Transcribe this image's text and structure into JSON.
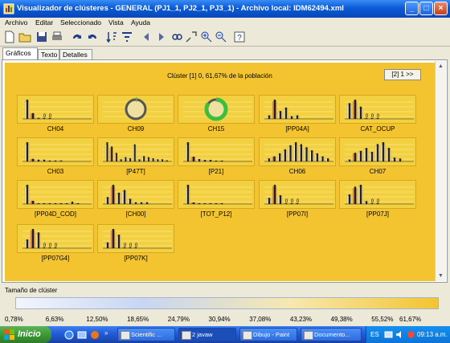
{
  "window": {
    "title": "Visualizador de clústeres - GENERAL (PJ1_1, PJ2_1, PJ3_1) - Archivo local: IDM62494.xml"
  },
  "menu": [
    "Archivo",
    "Editar",
    "Seleccionado",
    "Vista",
    "Ayuda"
  ],
  "toolbar": [
    "new-icon",
    "open-icon",
    "save-icon",
    "print-icon",
    "redo-icon",
    "undo-icon",
    "sort-icon",
    "filter-icon",
    "back-icon",
    "forward-icon",
    "link-icon",
    "zoom-fit-icon",
    "zoom-in-icon",
    "zoom-out-icon",
    "help-icon"
  ],
  "tabs": [
    "Gráficos",
    "Texto",
    "Detalles"
  ],
  "cluster": {
    "header": "Clúster [1] 0, 61,67% de la población",
    "nav_button": "[2] 1 >>"
  },
  "cells": [
    {
      "label": "CH04",
      "type": "bar",
      "values": [
        20,
        6,
        1,
        1,
        1
      ],
      "nums": [
        "",
        "",
        "",
        "0",
        "0"
      ]
    },
    {
      "label": "CH09",
      "type": "ring",
      "value": 0.02
    },
    {
      "label": "CH15",
      "type": "ring",
      "value": 0.85
    },
    {
      "label": "[PP04A]",
      "type": "bar",
      "values": [
        4,
        22,
        9,
        13,
        3,
        4
      ],
      "nums": []
    },
    {
      "label": "CAT_OCUP",
      "type": "bar",
      "values": [
        18,
        22,
        14,
        1,
        1,
        1
      ],
      "nums": [
        "",
        "",
        "",
        "0",
        "0",
        "0"
      ]
    },
    {
      "label": "CH03",
      "type": "bar",
      "values": [
        22,
        3,
        2,
        2,
        1,
        1,
        1
      ],
      "nums": []
    },
    {
      "label": "[P47T]",
      "type": "bar",
      "values": [
        18,
        14,
        8,
        2,
        4,
        3,
        16,
        2,
        5,
        4,
        3,
        2,
        2,
        1
      ],
      "nums": []
    },
    {
      "label": "[P21]",
      "type": "bar",
      "values": [
        24,
        6,
        3,
        2,
        2,
        1,
        1
      ],
      "nums": []
    },
    {
      "label": "CH06",
      "type": "bar",
      "values": [
        3,
        5,
        8,
        12,
        16,
        19,
        17,
        14,
        11,
        8,
        5,
        3
      ],
      "nums": []
    },
    {
      "label": "CH07",
      "type": "bar",
      "values": [
        2,
        9,
        11,
        14,
        10,
        18,
        20,
        14,
        4,
        3
      ],
      "nums": []
    },
    {
      "label": "[PP04D_COD]",
      "type": "bar",
      "values": [
        24,
        4,
        1,
        1,
        1,
        1,
        1,
        1,
        3,
        1
      ],
      "nums": []
    },
    {
      "label": "[CH00]",
      "type": "bar",
      "values": [
        8,
        22,
        13,
        16,
        6,
        2,
        2,
        2
      ],
      "nums": []
    },
    {
      "label": "[TOT_P12]",
      "type": "bar",
      "values": [
        24,
        2,
        1,
        1,
        1,
        1,
        1
      ],
      "nums": []
    },
    {
      "label": "[PP07I]",
      "type": "bar",
      "values": [
        7,
        22,
        10,
        1,
        1,
        1
      ],
      "nums": [
        "",
        "",
        "",
        "0",
        "0",
        "0"
      ]
    },
    {
      "label": "[PP07J]",
      "type": "bar",
      "values": [
        10,
        18,
        20,
        3,
        1,
        1
      ],
      "nums": [
        "",
        "",
        "",
        "",
        "0",
        "0"
      ]
    },
    {
      "label": "[PP07G4]",
      "type": "bar",
      "values": [
        10,
        22,
        18,
        1,
        1,
        1
      ],
      "nums": [
        "",
        "",
        "",
        "0",
        "0",
        "0"
      ]
    },
    {
      "label": "[PP07K]",
      "type": "bar",
      "values": [
        6,
        20,
        14,
        1,
        1,
        1
      ],
      "nums": [
        "",
        "",
        "",
        "0",
        "0",
        "0"
      ]
    }
  ],
  "size_bar": {
    "title": "Tamaño de clúster",
    "scale": [
      "0,78%",
      "6,63%",
      "12,50%",
      "18,65%",
      "24,79%",
      "30,94%",
      "37,08%",
      "43,23%",
      "49,38%",
      "55,52%",
      "61,67%"
    ]
  },
  "taskbar": {
    "start": "Inicio",
    "tasks": [
      "Scientific ...",
      "2 javaw",
      "Dibujo - Paint",
      "Documento..."
    ],
    "lang": "ES",
    "clock": "09:13 a.m."
  }
}
